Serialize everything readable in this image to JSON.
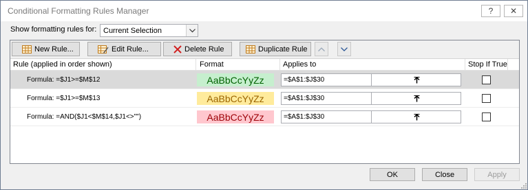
{
  "window": {
    "title": "Conditional Formatting Rules Manager",
    "help_label": "?",
    "close_label": "✕"
  },
  "show_rules": {
    "label": "Show formatting rules for:",
    "selected": "Current Selection"
  },
  "toolbar": {
    "new_rule": "New Rule...",
    "edit_rule": "Edit Rule...",
    "delete_rule": "Delete Rule",
    "duplicate_rule": "Duplicate Rule"
  },
  "columns": {
    "rule": "Rule (applied in order shown)",
    "format": "Format",
    "applies_to": "Applies to",
    "stop_if_true": "Stop If True"
  },
  "rules": [
    {
      "rule": "Formula: =$J1>=$M$12",
      "format_preview": "AaBbCcYyZz",
      "format_bg": "#c6efce",
      "format_color": "#006100",
      "applies_to": "=$A$1:$J$30",
      "stop_if_true": false,
      "selected": true
    },
    {
      "rule": "Formula: =$J1>=$M$13",
      "format_preview": "AaBbCcYyZz",
      "format_bg": "#ffeb9c",
      "format_color": "#9c6500",
      "applies_to": "=$A$1:$J$30",
      "stop_if_true": false,
      "selected": false
    },
    {
      "rule": "Formula: =AND($J1<$M$14,$J1<>\"\")",
      "format_preview": "AaBbCcYyZz",
      "format_bg": "#ffc7ce",
      "format_color": "#9c0006",
      "applies_to": "=$A$1:$J$30",
      "stop_if_true": false,
      "selected": false
    }
  ],
  "buttons": {
    "ok": "OK",
    "close": "Close",
    "apply": "Apply"
  }
}
